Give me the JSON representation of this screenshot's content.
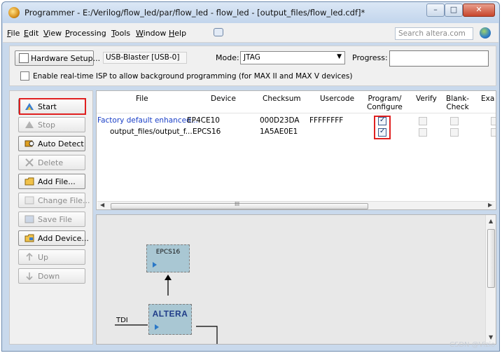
{
  "window": {
    "title": "Programmer - E:/Verilog/flow_led/par/flow_led - flow_led - [output_files/flow_led.cdf]*"
  },
  "menu": {
    "items": [
      "File",
      "Edit",
      "View",
      "Processing",
      "Tools",
      "Window",
      "Help"
    ],
    "search_placeholder": "Search altera.com"
  },
  "toolbar": {
    "hardware_setup_label": "Hardware Setup...",
    "hardware_name": "USB-Blaster [USB-0]",
    "mode_label": "Mode:",
    "mode_value": "JTAG",
    "progress_label": "Progress:",
    "isp_label": "Enable real-time ISP to allow background programming (for MAX II and MAX V devices)"
  },
  "sidebar": {
    "start": "Start",
    "stop": "Stop",
    "auto_detect": "Auto Detect",
    "delete": "Delete",
    "add_file": "Add File...",
    "change_file": "Change File...",
    "save_file": "Save File",
    "add_device": "Add Device...",
    "up": "Up",
    "down": "Down"
  },
  "table": {
    "columns": {
      "file": "File",
      "device": "Device",
      "checksum": "Checksum",
      "usercode": "Usercode",
      "program_configure_1": "Program/",
      "program_configure_2": "Configure",
      "verify": "Verify",
      "blank_check_1": "Blank-",
      "blank_check_2": "Check",
      "examine": "Exa"
    },
    "rows": [
      {
        "file": "Factory default enhanced...",
        "device": "EP4CE10",
        "checksum": "000D23DA",
        "usercode": "FFFFFFFF",
        "program_configure": true,
        "verify": false,
        "blank_check": false
      },
      {
        "file": "output_files/output_f...",
        "device": "EPCS16",
        "checksum": "1A5AE0E1",
        "usercode": "",
        "program_configure": true,
        "verify": false,
        "blank_check": false
      }
    ],
    "scroll_grip": "III"
  },
  "chain": {
    "epcs_label": "EPCS16",
    "altera_label": "ALTERA",
    "tdi_label": "TDI"
  },
  "watermark": "CSDN @Vizio"
}
